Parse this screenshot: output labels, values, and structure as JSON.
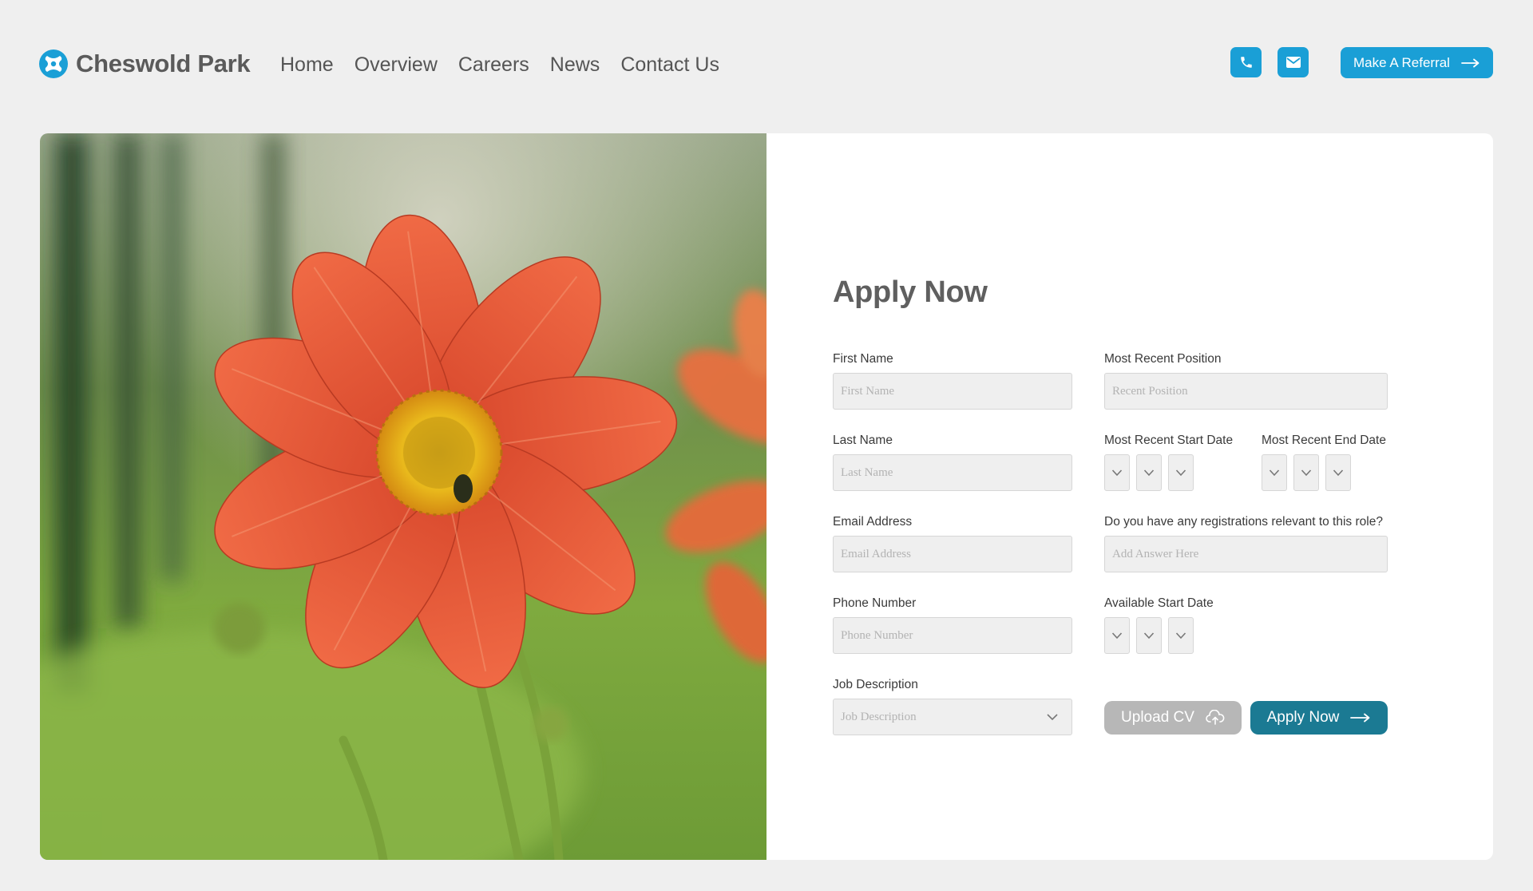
{
  "brand": {
    "name": "Cheswold Park",
    "accent": "#1a9fd6",
    "primary_button": "#1b7a93"
  },
  "nav": {
    "items": [
      {
        "label": "Home"
      },
      {
        "label": "Overview"
      },
      {
        "label": "Careers"
      },
      {
        "label": "News"
      },
      {
        "label": "Contact Us"
      }
    ]
  },
  "header": {
    "phone_icon": "phone-icon",
    "mail_icon": "envelope-icon",
    "referral_label": "Make A Referral"
  },
  "hero": {
    "image": "orange-dahlia-flower-photo"
  },
  "form": {
    "title": "Apply Now",
    "first_name": {
      "label": "First Name",
      "placeholder": "First Name"
    },
    "last_name": {
      "label": "Last Name",
      "placeholder": "Last Name"
    },
    "email": {
      "label": "Email Address",
      "placeholder": "Email Address"
    },
    "phone": {
      "label": "Phone Number",
      "placeholder": "Phone Number"
    },
    "job_description": {
      "label": "Job Description",
      "placeholder": "Job Description"
    },
    "recent_position": {
      "label": "Most Recent Position",
      "placeholder": "Recent Position"
    },
    "recent_start_date": {
      "label": "Most Recent Start Date"
    },
    "recent_end_date": {
      "label": "Most Recent End Date"
    },
    "registrations": {
      "label": "Do you have any registrations relevant to this role?",
      "placeholder": "Add Answer Here"
    },
    "available_start_date": {
      "label": "Available Start Date"
    },
    "upload_label": "Upload CV",
    "apply_label": "Apply Now"
  }
}
